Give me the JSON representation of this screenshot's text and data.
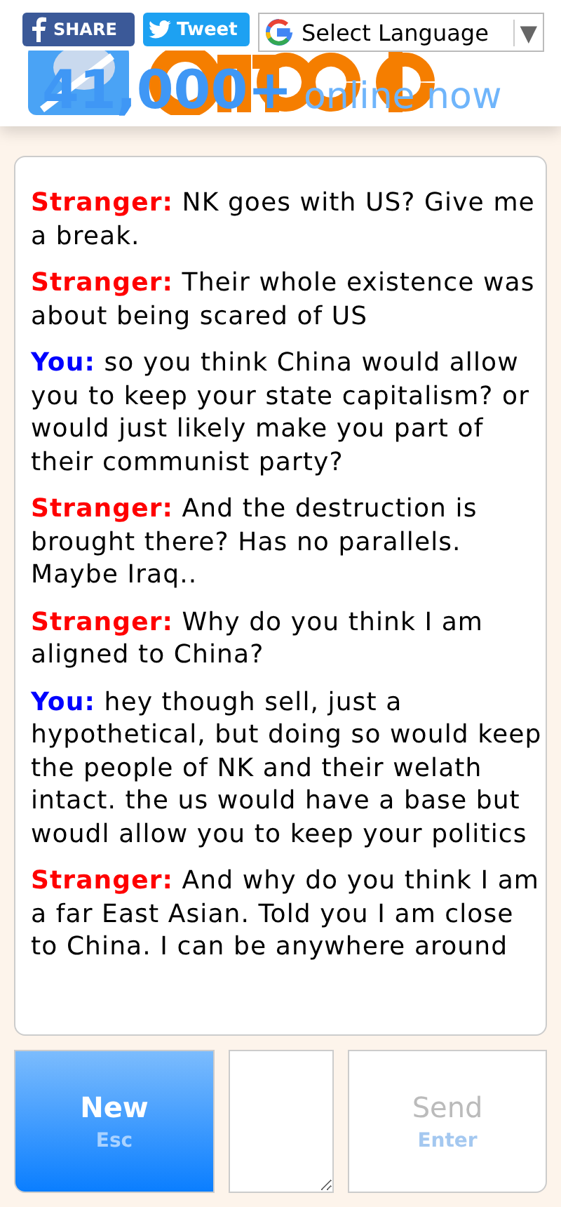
{
  "header": {
    "share_buttons": [
      {
        "kind": "facebook",
        "label": "SHARE"
      },
      {
        "kind": "twitter",
        "label": "Tweet"
      }
    ],
    "language_select": {
      "label": "Select Language",
      "arrow": "▼"
    },
    "online_count": {
      "count": "41,000+",
      "label": "online now"
    }
  },
  "chat": {
    "messages": [
      {
        "sender": "Stranger:",
        "kind": "stranger",
        "text": "NK goes with US? Give me a break."
      },
      {
        "sender": "Stranger:",
        "kind": "stranger",
        "text": "Their whole existence was about being scared of US"
      },
      {
        "sender": "You:",
        "kind": "you",
        "text": "so you think China would allow you to keep your state capitalism? or would just likely make you part of their communist party?"
      },
      {
        "sender": "Stranger:",
        "kind": "stranger",
        "text": "And the destruction is brought there? Has no parallels. Maybe Iraq.."
      },
      {
        "sender": "Stranger:",
        "kind": "stranger",
        "text": "Why do you think I am aligned to China?"
      },
      {
        "sender": "You:",
        "kind": "you",
        "text": "hey though sell, just a hypothetical, but doing so would keep the people of NK and their welath intact. the us would have a base but woudl allow you to keep your politics"
      },
      {
        "sender": "Stranger:",
        "kind": "stranger",
        "text": "And why do you think I am a far East Asian. Told you I am close to China. I can be anywhere around"
      }
    ]
  },
  "controls": {
    "new_button": {
      "label": "New",
      "key": "Esc"
    },
    "send_button": {
      "label": "Send",
      "key": "Enter",
      "disabled": true
    }
  }
}
